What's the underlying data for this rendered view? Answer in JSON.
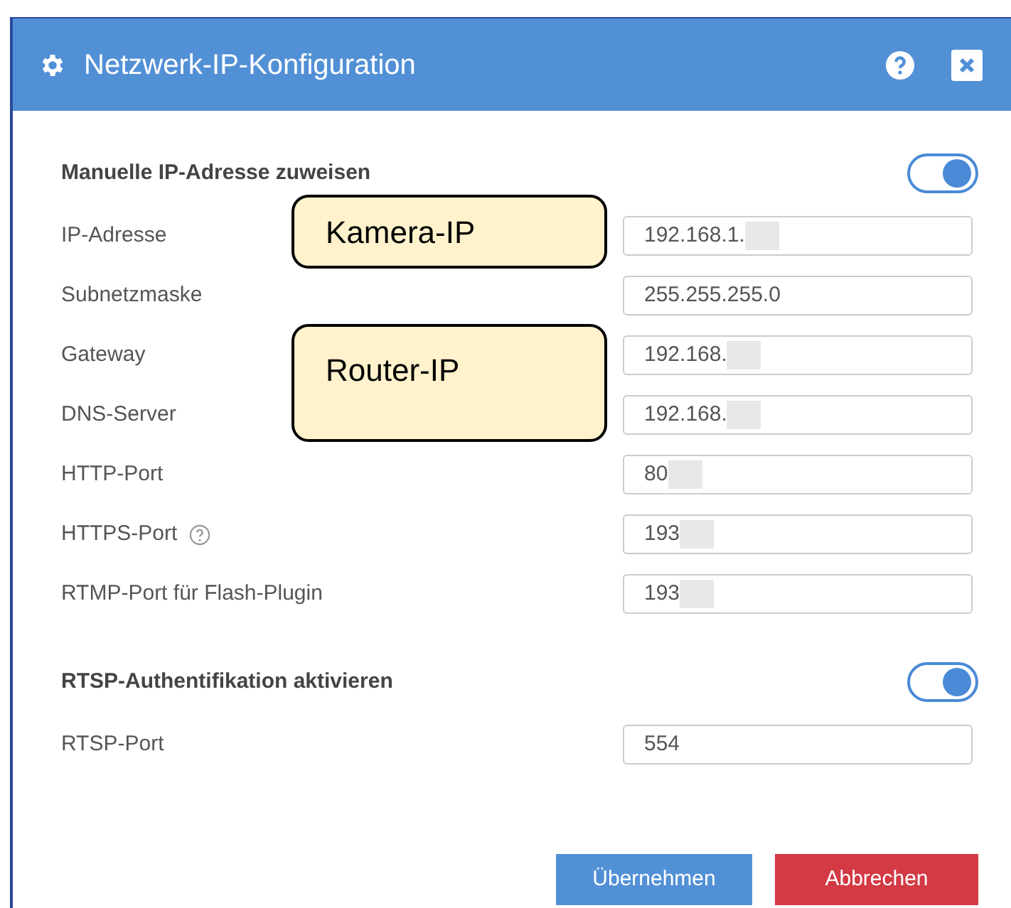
{
  "window": {
    "title": "Netzwerk-IP-Konfiguration"
  },
  "sections": [
    {
      "heading": "Manuelle IP-Adresse zuweisen",
      "toggle_on": true,
      "fields": [
        {
          "label": "IP-Adresse",
          "value": "192.168.1.",
          "redacted": true,
          "help": false
        },
        {
          "label": "Subnetzmaske",
          "value": "255.255.255.0",
          "redacted": false,
          "help": false
        },
        {
          "label": "Gateway",
          "value": "192.168.",
          "redacted": true,
          "help": false
        },
        {
          "label": "DNS-Server",
          "value": "192.168.",
          "redacted": true,
          "help": false
        },
        {
          "label": "HTTP-Port",
          "value": "80",
          "redacted": true,
          "help": false
        },
        {
          "label": "HTTPS-Port",
          "value": "193",
          "redacted": true,
          "help": true
        },
        {
          "label": "RTMP-Port für Flash-Plugin",
          "value": "193",
          "redacted": true,
          "help": false
        }
      ]
    },
    {
      "heading": "RTSP-Authentifikation aktivieren",
      "toggle_on": true,
      "fields": [
        {
          "label": "RTSP-Port",
          "value": "554",
          "redacted": false,
          "help": false
        }
      ]
    }
  ],
  "annotations": [
    {
      "text": "Kamera-IP",
      "kind": "short"
    },
    {
      "text": "Router-IP",
      "kind": "tall"
    }
  ],
  "buttons": [
    {
      "label": "Übernehmen",
      "kind": "primary"
    },
    {
      "label": "Abbrechen",
      "kind": "danger"
    }
  ]
}
